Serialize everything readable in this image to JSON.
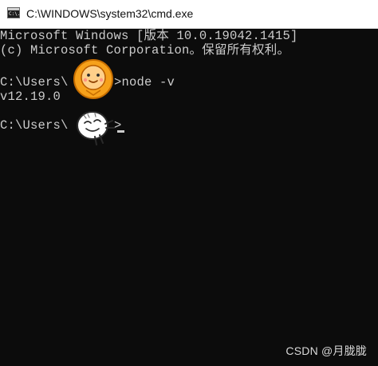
{
  "window": {
    "title": "C:\\WINDOWS\\system32\\cmd.exe",
    "icon": "cmd-window-icon",
    "icon_text": "C:\\."
  },
  "console": {
    "lines": [
      "Microsoft Windows [版本 10.0.19042.1415]",
      "(c) Microsoft Corporation。保留所有权利。",
      "",
      "C:\\Users\\",
      "v12.19.0",
      "",
      "C:\\Users\\"
    ],
    "command_suffix": ">node -v",
    "prompt_suffix": ">",
    "text_color": "#cccccc",
    "background": "#0c0c0c"
  },
  "stickers": {
    "lion": "lion-sticker",
    "smiley": "smiley-face-sticker"
  },
  "watermark": "CSDN @月胧胧"
}
